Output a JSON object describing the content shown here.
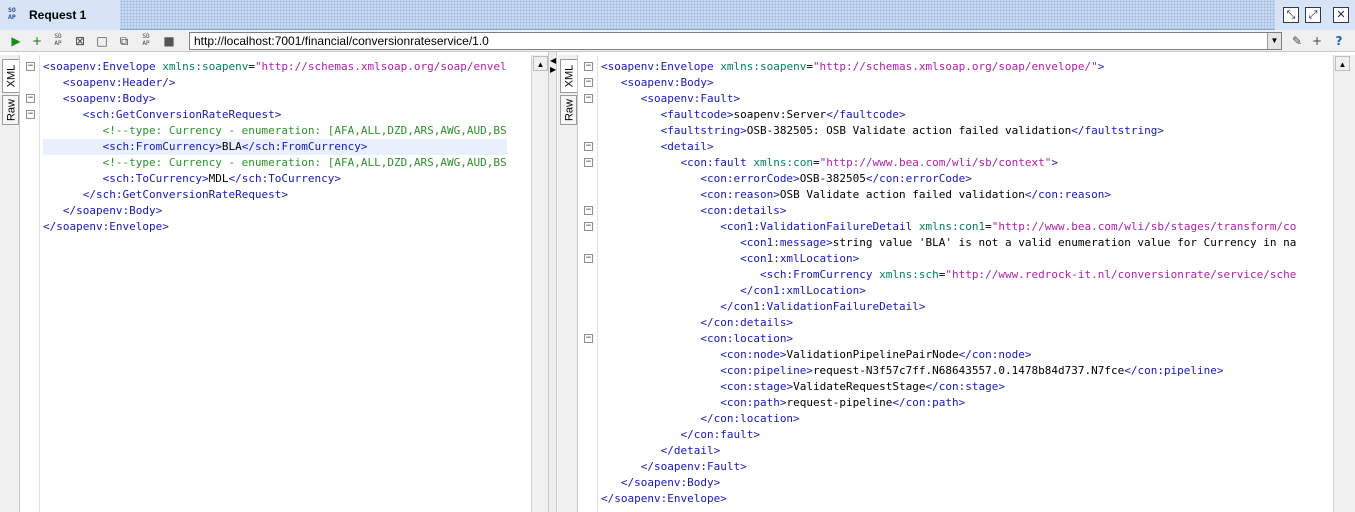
{
  "window": {
    "title": "Request 1",
    "badge": "SO\nAP"
  },
  "toolbar": {
    "url": "http://localhost:7001/financial/conversionrateservice/1.0"
  },
  "left_panel": {
    "tabs": [
      "XML",
      "Raw"
    ],
    "lines": [
      [
        [
          "t",
          "<soapenv:Envelope "
        ],
        [
          "a",
          "xmlns:soapenv"
        ],
        [
          "x",
          "="
        ],
        [
          "v",
          "\"http://schemas.xmlsoap.org/soap/envel"
        ]
      ],
      [
        [
          "x",
          "   "
        ],
        [
          "t",
          "<soapenv:Header/>"
        ]
      ],
      [
        [
          "x",
          "   "
        ],
        [
          "t",
          "<soapenv:Body>"
        ]
      ],
      [
        [
          "x",
          "      "
        ],
        [
          "t",
          "<sch:GetConversionRateRequest>"
        ]
      ],
      [
        [
          "x",
          "         "
        ],
        [
          "c",
          "<!--type: Currency - enumeration: [AFA,ALL,DZD,ARS,AWG,AUD,BS"
        ]
      ],
      [
        [
          "x",
          "         "
        ],
        [
          "t",
          "<sch:FromCurrency>"
        ],
        [
          "x",
          "BLA"
        ],
        [
          "t",
          "</sch:FromCurrency>"
        ]
      ],
      [
        [
          "x",
          "         "
        ],
        [
          "c",
          "<!--type: Currency - enumeration: [AFA,ALL,DZD,ARS,AWG,AUD,BS"
        ]
      ],
      [
        [
          "x",
          "         "
        ],
        [
          "t",
          "<sch:ToCurrency>"
        ],
        [
          "x",
          "MDL"
        ],
        [
          "t",
          "</sch:ToCurrency>"
        ]
      ],
      [
        [
          "x",
          "      "
        ],
        [
          "t",
          "</sch:GetConversionRateRequest>"
        ]
      ],
      [
        [
          "x",
          "   "
        ],
        [
          "t",
          "</soapenv:Body>"
        ]
      ],
      [
        [
          "t",
          "</soapenv:Envelope>"
        ]
      ]
    ]
  },
  "right_panel": {
    "tabs": [
      "XML",
      "Raw"
    ],
    "lines": [
      [
        [
          "t",
          "<soapenv:Envelope "
        ],
        [
          "a",
          "xmlns:soapenv"
        ],
        [
          "x",
          "="
        ],
        [
          "v",
          "\"http://schemas.xmlsoap.org/soap/envelope/\""
        ],
        [
          "t",
          ">"
        ]
      ],
      [
        [
          "x",
          "   "
        ],
        [
          "t",
          "<soapenv:Body>"
        ]
      ],
      [
        [
          "x",
          "      "
        ],
        [
          "t",
          "<soapenv:Fault>"
        ]
      ],
      [
        [
          "x",
          "         "
        ],
        [
          "t",
          "<faultcode>"
        ],
        [
          "x",
          "soapenv:Server"
        ],
        [
          "t",
          "</faultcode>"
        ]
      ],
      [
        [
          "x",
          "         "
        ],
        [
          "t",
          "<faultstring>"
        ],
        [
          "x",
          "OSB-382505: OSB Validate action failed validation"
        ],
        [
          "t",
          "</faultstring>"
        ]
      ],
      [
        [
          "x",
          "         "
        ],
        [
          "t",
          "<detail>"
        ]
      ],
      [
        [
          "x",
          "            "
        ],
        [
          "t",
          "<con:fault "
        ],
        [
          "a",
          "xmlns:con"
        ],
        [
          "x",
          "="
        ],
        [
          "v",
          "\"http://www.bea.com/wli/sb/context\""
        ],
        [
          "t",
          ">"
        ]
      ],
      [
        [
          "x",
          "               "
        ],
        [
          "t",
          "<con:errorCode>"
        ],
        [
          "x",
          "OSB-382505"
        ],
        [
          "t",
          "</con:errorCode>"
        ]
      ],
      [
        [
          "x",
          "               "
        ],
        [
          "t",
          "<con:reason>"
        ],
        [
          "x",
          "OSB Validate action failed validation"
        ],
        [
          "t",
          "</con:reason>"
        ]
      ],
      [
        [
          "x",
          "               "
        ],
        [
          "t",
          "<con:details>"
        ]
      ],
      [
        [
          "x",
          "                  "
        ],
        [
          "t",
          "<con1:ValidationFailureDetail "
        ],
        [
          "a",
          "xmlns:con1"
        ],
        [
          "x",
          "="
        ],
        [
          "v",
          "\"http://www.bea.com/wli/sb/stages/transform/co"
        ]
      ],
      [
        [
          "x",
          "                     "
        ],
        [
          "t",
          "<con1:message>"
        ],
        [
          "x",
          "string value 'BLA' is not a valid enumeration value for Currency in na"
        ]
      ],
      [
        [
          "x",
          "                     "
        ],
        [
          "t",
          "<con1:xmlLocation>"
        ]
      ],
      [
        [
          "x",
          "                        "
        ],
        [
          "t",
          "<sch:FromCurrency "
        ],
        [
          "a",
          "xmlns:sch"
        ],
        [
          "x",
          "="
        ],
        [
          "v",
          "\"http://www.redrock-it.nl/conversionrate/service/sche"
        ]
      ],
      [
        [
          "x",
          "                     "
        ],
        [
          "t",
          "</con1:xmlLocation>"
        ]
      ],
      [
        [
          "x",
          "                  "
        ],
        [
          "t",
          "</con1:ValidationFailureDetail>"
        ]
      ],
      [
        [
          "x",
          "               "
        ],
        [
          "t",
          "</con:details>"
        ]
      ],
      [
        [
          "x",
          "               "
        ],
        [
          "t",
          "<con:location>"
        ]
      ],
      [
        [
          "x",
          "                  "
        ],
        [
          "t",
          "<con:node>"
        ],
        [
          "x",
          "ValidationPipelinePairNode"
        ],
        [
          "t",
          "</con:node>"
        ]
      ],
      [
        [
          "x",
          "                  "
        ],
        [
          "t",
          "<con:pipeline>"
        ],
        [
          "x",
          "request-N3f57c7ff.N68643557.0.1478b84d737.N7fce"
        ],
        [
          "t",
          "</con:pipeline>"
        ]
      ],
      [
        [
          "x",
          "                  "
        ],
        [
          "t",
          "<con:stage>"
        ],
        [
          "x",
          "ValidateRequestStage"
        ],
        [
          "t",
          "</con:stage>"
        ]
      ],
      [
        [
          "x",
          "                  "
        ],
        [
          "t",
          "<con:path>"
        ],
        [
          "x",
          "request-pipeline"
        ],
        [
          "t",
          "</con:path>"
        ]
      ],
      [
        [
          "x",
          "               "
        ],
        [
          "t",
          "</con:location>"
        ]
      ],
      [
        [
          "x",
          "            "
        ],
        [
          "t",
          "</con:fault>"
        ]
      ],
      [
        [
          "x",
          "         "
        ],
        [
          "t",
          "</detail>"
        ]
      ],
      [
        [
          "x",
          "      "
        ],
        [
          "t",
          "</soapenv:Fault>"
        ]
      ],
      [
        [
          "x",
          "   "
        ],
        [
          "t",
          "</soapenv:Body>"
        ]
      ],
      [
        [
          "t",
          "</soapenv:Envelope>"
        ]
      ]
    ]
  },
  "icons": {
    "submit": "play-icon",
    "add_step": "add-step-icon",
    "soap": "soap-icon",
    "maximize": "maximize-icon",
    "close": "close-icon",
    "help": "help-icon"
  }
}
